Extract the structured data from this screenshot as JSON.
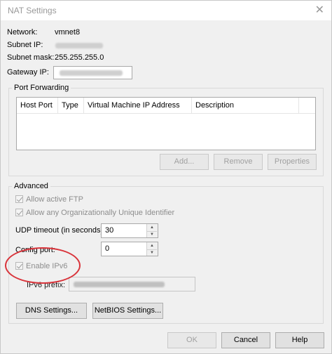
{
  "window": {
    "title": "NAT Settings",
    "close_glyph": "✕"
  },
  "network": {
    "label": "Network:",
    "value": "vmnet8"
  },
  "subnet_ip": {
    "label": "Subnet IP:"
  },
  "subnet_mask": {
    "label": "Subnet mask:",
    "value": "255.255.255.0"
  },
  "gateway_ip": {
    "label": "Gateway IP:"
  },
  "port_forwarding": {
    "title": "Port Forwarding",
    "columns": [
      "Host Port",
      "Type",
      "Virtual Machine IP Address",
      "Description"
    ],
    "buttons": {
      "add": "Add...",
      "remove": "Remove",
      "properties": "Properties"
    }
  },
  "advanced": {
    "title": "Advanced",
    "allow_active_ftp": "Allow active FTP",
    "allow_oui": "Allow any Organizationally Unique Identifier",
    "udp_timeout": {
      "label": "UDP timeout (in seconds):",
      "value": "30"
    },
    "config_port": {
      "label": "Config port:",
      "value": "0"
    },
    "enable_ipv6": "Enable IPv6",
    "ipv6_prefix": {
      "label": "IPv6 prefix:"
    },
    "dns_settings": "DNS Settings...",
    "netbios_settings": "NetBIOS Settings..."
  },
  "footer": {
    "ok": "OK",
    "cancel": "Cancel",
    "help": "Help"
  },
  "annotation_color": "#d9343b"
}
